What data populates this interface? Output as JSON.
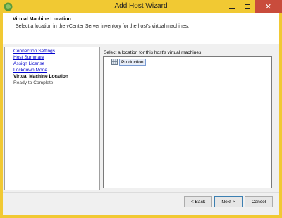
{
  "window": {
    "title": "Add Host Wizard",
    "icon": "vsphere-icon",
    "controls": {
      "minimize": "minimize-icon",
      "maximize": "maximize-icon",
      "close": "✕"
    }
  },
  "header": {
    "title": "Virtual Machine Location",
    "description": "Select a location in the vCenter Server inventory for the host's virtual machines."
  },
  "steps": [
    {
      "label": "Connection Settings",
      "state": "link"
    },
    {
      "label": "Host Summary",
      "state": "link"
    },
    {
      "label": "Assign License",
      "state": "link"
    },
    {
      "label": "Lockdown Mode",
      "state": "link"
    },
    {
      "label": "Virtual Machine Location",
      "state": "current"
    },
    {
      "label": "Ready to Complete",
      "state": "pending"
    }
  ],
  "main": {
    "prompt": "Select a location for this host's virtual machines.",
    "tree": [
      {
        "label": "Production",
        "icon": "datacenter-icon",
        "selected": true
      }
    ]
  },
  "buttons": {
    "back": "< Back",
    "next": "Next >",
    "cancel": "Cancel"
  },
  "colors": {
    "frame": "#f1c933",
    "close_button": "#c94c3c",
    "link": "#0000cc"
  }
}
